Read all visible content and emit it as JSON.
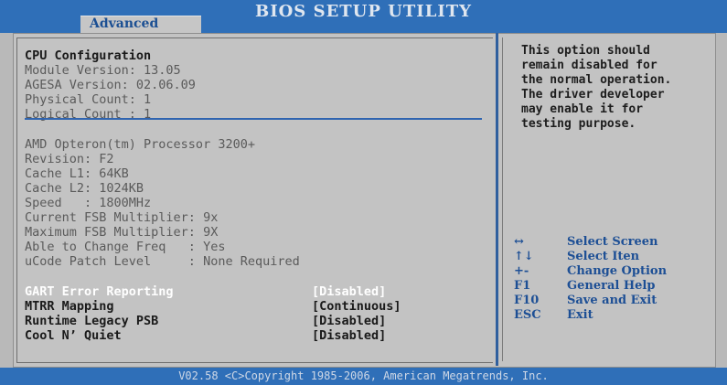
{
  "header": {
    "title": "BIOS SETUP UTILITY",
    "active_tab": "Advanced"
  },
  "info": {
    "heading": "CPU Configuration",
    "lines": [
      "Module Version: 13.05",
      "AGESA Version: 02.06.09",
      "Physical Count: 1",
      "Logical Count : 1"
    ],
    "processor": [
      "AMD Opteron(tm) Processor 3200+",
      "Revision: F2",
      "Cache L1: 64KB",
      "Cache L2: 1024KB",
      "Speed   : 1800MHz",
      "Current FSB Multiplier: 9x",
      "Maximum FSB Multiplier: 9X",
      "Able to Change Freq   : Yes",
      "uCode Patch Level     : None Required"
    ]
  },
  "settings": [
    {
      "label": "GART Error Reporting",
      "value": "[Disabled]",
      "selected": true
    },
    {
      "label": "MTRR Mapping",
      "value": "[Continuous]",
      "selected": false
    },
    {
      "label": "Runtime Legacy PSB",
      "value": "[Disabled]",
      "selected": false
    },
    {
      "label": "Cool N’ Quiet",
      "value": "[Disabled]",
      "selected": false
    }
  ],
  "help": {
    "text": "This option should\nremain disabled for\nthe normal operation.\nThe driver developer\nmay enable it for\ntesting purpose."
  },
  "keys": [
    {
      "key": "↔",
      "desc": "Select Screen"
    },
    {
      "key": "↑↓",
      "desc": "Select Iten"
    },
    {
      "key": "+-",
      "desc": "Change Option"
    },
    {
      "key": "F1",
      "desc": "General Help"
    },
    {
      "key": "F10",
      "desc": "Save and Exit"
    },
    {
      "key": "ESC",
      "desc": "Exit"
    }
  ],
  "footer": {
    "text": "V02.58 <C>Copyright 1985-2006, American Megatrends, Inc."
  },
  "colors": {
    "bar": "#2f6fb8",
    "panel": "#c3c3c3",
    "selected_text": "#ffffff",
    "key_text": "#1d4f95"
  }
}
